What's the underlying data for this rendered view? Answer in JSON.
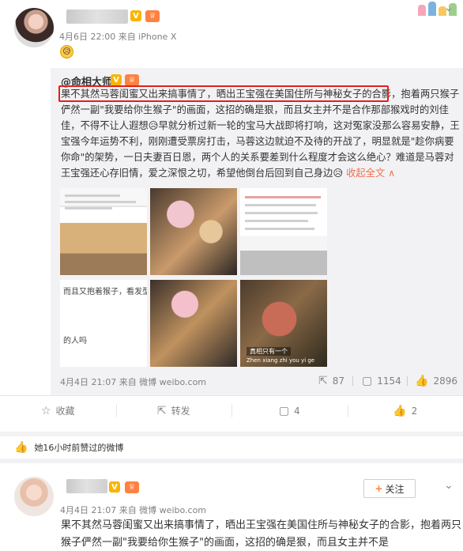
{
  "post1": {
    "meta": "4月6日 22:00 来自 iPhone X",
    "emoji": "😥",
    "repost": {
      "author": "@命相大师",
      "highlight": "果不其然马蓉闺蜜又出来搞事情了，晒出王宝强在美国住所与神秘女子的合影，",
      "body": "抱着两只猴子俨然一副\"我要给你生猴子\"的画面，这招的确是狠，而且女主并不是合作那部猴戏时的刘佳佳，不得不让人遐想😥早就分析过新一轮的宝马大战即将打响，这对冤家没那么容易安静，王宝强今年运势不利，刚刚遭受票房打击，马蓉这边就迫不及待的开战了，明显就是\"趁你病要你命\"的架势，一日夫妻百日恩，两个人的关系要差到什么程度才会这么绝心？难道是马蓉对王宝强还心存旧情，爱之深恨之切，希望他倒台后回到自己身边😥",
      "collapse": "收起全文 ∧",
      "photo_texts": {
        "p4_line1": "而且又抱着猴子，看发型",
        "p4_line2": "的人吗",
        "p6_sub1": "真相只有一个",
        "p6_sub2": "Zhen xiang zhi you yi ge"
      },
      "meta": "4月4日 21:07 来自 微博 weibo.com",
      "counts": {
        "repost": "87",
        "comment": "1154",
        "like": "2896"
      }
    },
    "actions": {
      "favorite": "收藏",
      "forward": "转发",
      "comment": "4",
      "like": "2"
    }
  },
  "liked_note": "她16小时前赞过的微博",
  "post2": {
    "meta": "4月4日 21:07 来自 微博 weibo.com",
    "follow_label": "关注",
    "body": "果不其然马蓉闺蜜又出来搞事情了，晒出王宝强在美国住所与神秘女子的合影，抱着两只猴子俨然一副\"我要给你生猴子\"的画面，这招的确是狠，而且女主并不是"
  },
  "colors": {
    "accent": "#eb7350",
    "highlight_border": "#e0201b",
    "vip": "#ff8140",
    "verified": "#f7b500"
  },
  "icons": [
    "chevron-down-icon",
    "star-icon",
    "forward-icon",
    "comment-icon",
    "like-icon",
    "repost-icon",
    "plus-icon"
  ]
}
